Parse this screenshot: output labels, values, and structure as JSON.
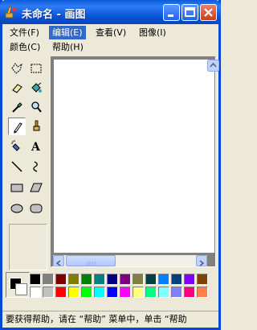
{
  "window": {
    "title": "未命名 - 画图"
  },
  "menu": [
    {
      "label": "文件(F)"
    },
    {
      "label": "编辑(E)"
    },
    {
      "label": "查看(V)"
    },
    {
      "label": "图像(I)"
    },
    {
      "label": "颜色(C)"
    },
    {
      "label": "帮助(H)"
    }
  ],
  "tools": [
    "free-form-select-icon",
    "select-icon",
    "eraser-icon",
    "fill-icon",
    "color-picker-icon",
    "magnifier-icon",
    "pencil-icon",
    "brush-icon",
    "airbrush-icon",
    "text-icon",
    "line-icon",
    "curve-icon",
    "rectangle-icon",
    "polygon-icon",
    "ellipse-icon",
    "rounded-rectangle-icon"
  ],
  "palette": {
    "foreground": "#000000",
    "background": "#ffffff",
    "row1": [
      "#000000",
      "#808080",
      "#800000",
      "#808000",
      "#008000",
      "#008080",
      "#000080",
      "#800080",
      "#808040",
      "#004040",
      "#0080ff",
      "#004080",
      "#8000ff",
      "#804000"
    ],
    "row2": [
      "#ffffff",
      "#c0c0c0",
      "#ff0000",
      "#ffff00",
      "#00ff00",
      "#00ffff",
      "#0000ff",
      "#ff00ff",
      "#ffff80",
      "#00ff80",
      "#80ffff",
      "#8080ff",
      "#ff0080",
      "#ff8040"
    ]
  },
  "status": {
    "text": "要获得帮助，请在 “帮助” 菜单中，单击 “帮助"
  }
}
